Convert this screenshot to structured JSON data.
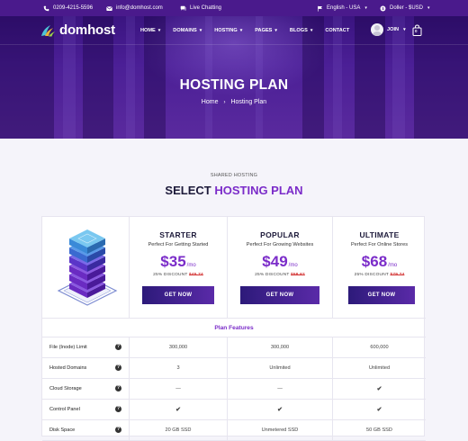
{
  "topbar": {
    "phone": "0209-4215-5596",
    "email": "info@domhost.com",
    "chat": "Live Chatting",
    "language": "English - USA",
    "currency": "Doller - $USD"
  },
  "brand": {
    "name": "domhost"
  },
  "nav": {
    "items": [
      "HOME",
      "DOMAINS",
      "HOSTING",
      "PAGES",
      "BLOGS",
      "CONTACT"
    ],
    "join": "JOIN",
    "cart_count": "0"
  },
  "hero": {
    "title": "HOSTING PLAN",
    "breadcrumb": {
      "home": "Home",
      "current": "Hosting Plan"
    }
  },
  "section": {
    "eyebrow": "SHARED HOSTING",
    "title_plain": "SELECT",
    "title_accent": "HOSTING PLAN"
  },
  "plans": [
    {
      "name": "STARTER",
      "subtitle": "Perfect For Getting Started",
      "price": "$35",
      "per": "/mo",
      "discount_label": "25% DISCOUNT",
      "old_price": "$45.74",
      "button": "GET NOW"
    },
    {
      "name": "POPULAR",
      "subtitle": "Perfect For Growing Websites",
      "price": "$49",
      "per": "/mo",
      "discount_label": "25% DISCOUNT",
      "old_price": "$59.62",
      "button": "GET NOW"
    },
    {
      "name": "ULTIMATE",
      "subtitle": "Perfect For Online Stores",
      "price": "$68",
      "per": "/mo",
      "discount_label": "25% DISCOUNT",
      "old_price": "$79.74",
      "button": "GET NOW"
    }
  ],
  "features": {
    "heading": "Plan Features",
    "rows": [
      {
        "label": "File (Inode) Limit",
        "values": [
          "300,000",
          "300,000",
          "600,000"
        ]
      },
      {
        "label": "Hosted Domains",
        "values": [
          "3",
          "Unlimited",
          "Unlimited"
        ]
      },
      {
        "label": "Cloud Storage",
        "values": [
          "—",
          "—",
          "✔"
        ]
      },
      {
        "label": "Control Panel",
        "values": [
          "✔",
          "✔",
          "✔"
        ]
      },
      {
        "label": "Disk Space",
        "values": [
          "20 GB SSD",
          "Unmetered SSD",
          "50 GB SSD"
        ]
      }
    ]
  },
  "colors": {
    "brand_purple": "#4a1a8c",
    "accent": "#7b2cc9",
    "old_price_red": "#d23030"
  },
  "icons": [
    "phone-icon",
    "mail-icon",
    "chat-icon",
    "flag-icon",
    "currency-icon",
    "logo-icon",
    "user-icon",
    "cart-icon",
    "server-illustration",
    "help-icon",
    "check-icon"
  ]
}
